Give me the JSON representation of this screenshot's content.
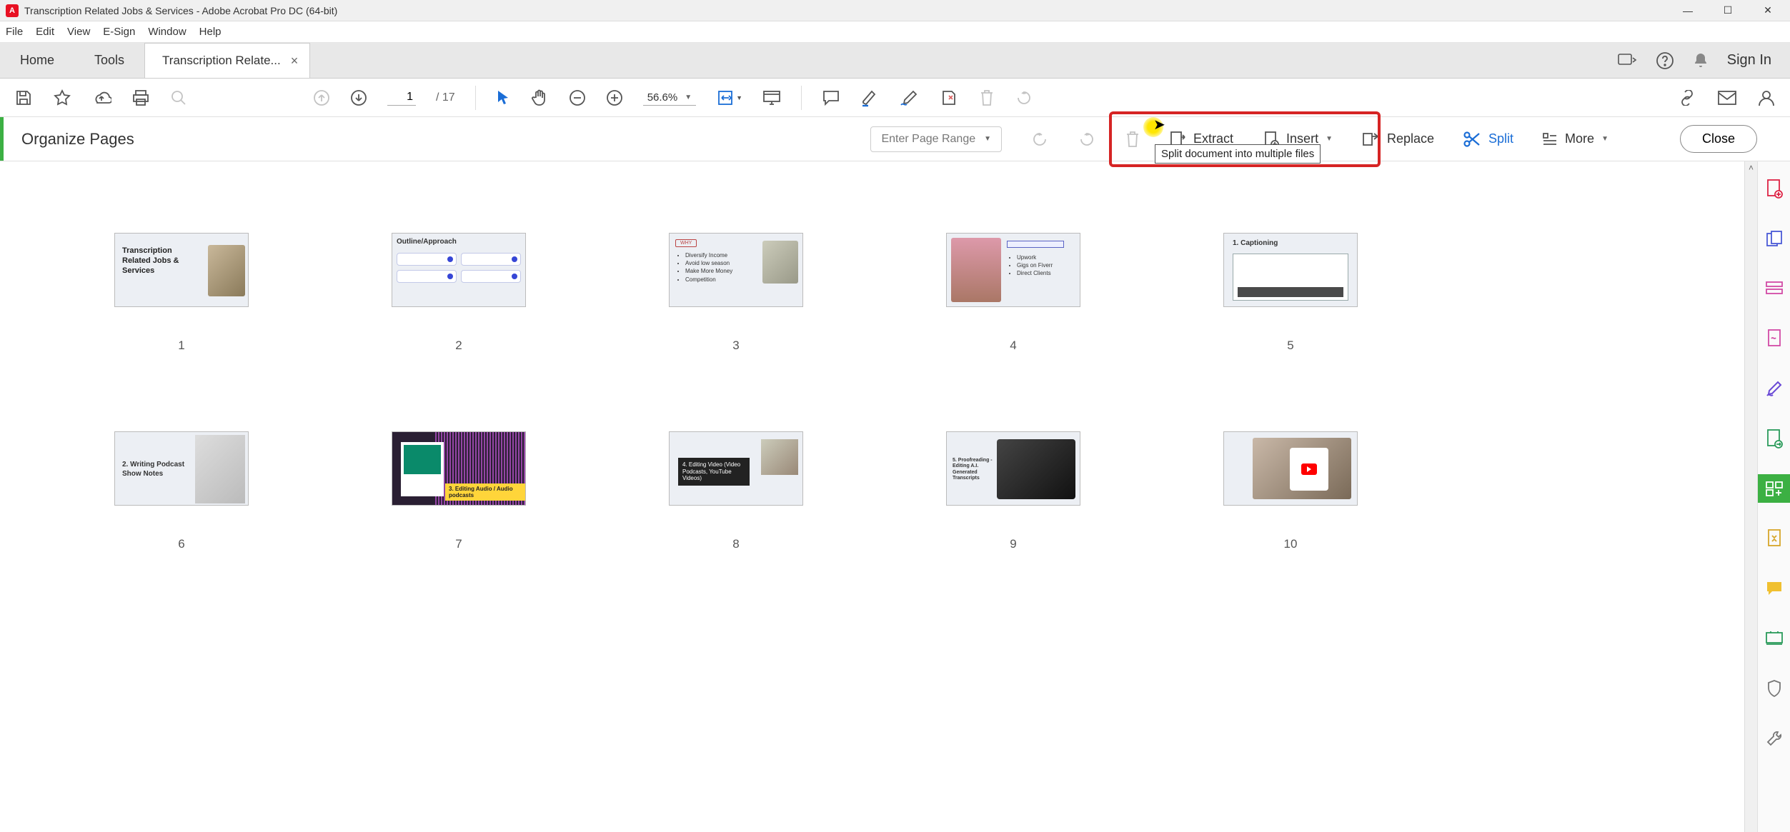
{
  "window": {
    "title": "Transcription Related Jobs & Services - Adobe Acrobat Pro DC (64-bit)",
    "app_badge": "A"
  },
  "menu": {
    "items": [
      "File",
      "Edit",
      "View",
      "E-Sign",
      "Window",
      "Help"
    ]
  },
  "tabs": {
    "home": "Home",
    "tools": "Tools",
    "document": "Transcription Relate...",
    "signin": "Sign In"
  },
  "toolbar": {
    "page_current": "1",
    "page_total": "/  17",
    "zoom": "56.6%"
  },
  "organize": {
    "title": "Organize Pages",
    "page_range_placeholder": "Enter Page Range",
    "extract": "Extract",
    "insert": "Insert",
    "replace": "Replace",
    "split": "Split",
    "more": "More",
    "close": "Close",
    "split_tooltip": "Split document into multiple files"
  },
  "thumbnails": [
    {
      "num": "1",
      "title": "Transcription Related Jobs & Services"
    },
    {
      "num": "2",
      "title": "Outline/Approach"
    },
    {
      "num": "3",
      "bullets": [
        "Diversify Income",
        "Avoid low season",
        "Make More Money",
        "Competition"
      ]
    },
    {
      "num": "4",
      "bullets": [
        "Upwork",
        "Gigs on Fiverr",
        "Direct Clients"
      ]
    },
    {
      "num": "5",
      "title": "1. Captioning"
    },
    {
      "num": "6",
      "title": "2. Writing Podcast Show Notes"
    },
    {
      "num": "7",
      "title": "3. Editing Audio / Audio podcasts"
    },
    {
      "num": "8",
      "title": "4. Editing Video (Video Podcasts, YouTube Videos)"
    },
    {
      "num": "9",
      "title": "5. Proofreading - Editing A.I. Generated Transcripts"
    },
    {
      "num": "10"
    }
  ]
}
